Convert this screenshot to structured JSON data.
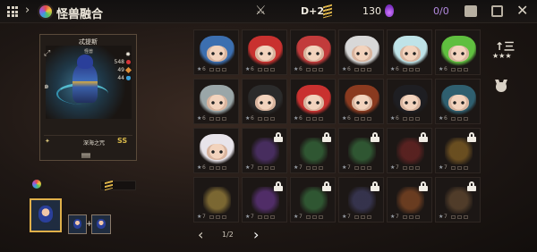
{
  "header": {
    "title": "怪兽融合",
    "level": "D+2",
    "gems": "130",
    "ratio": "0/0",
    "back_chevron": "›"
  },
  "detail": {
    "name": "忒提斯",
    "subtitle": "怪兽",
    "stats": {
      "hp": "548",
      "atk": "49",
      "def": "44"
    },
    "skill_name": "深海之咒",
    "skill_level": "SS"
  },
  "side": {
    "sort_label": "↑三",
    "stars_label": "★★★"
  },
  "pagination": {
    "text": "1/2",
    "prev": "‹",
    "next": "›"
  },
  "grid": {
    "cells": [
      {
        "row": 0,
        "col": 0,
        "type": "hero",
        "star": "★",
        "lv": "6",
        "hair": "#3c6fb0",
        "locked": false
      },
      {
        "row": 0,
        "col": 1,
        "type": "hero",
        "star": "★",
        "lv": "6",
        "hair": "#c9312f",
        "locked": false
      },
      {
        "row": 0,
        "col": 2,
        "type": "hero",
        "star": "★",
        "lv": "6",
        "hair": "#c23b3b",
        "locked": false
      },
      {
        "row": 0,
        "col": 3,
        "type": "hero",
        "star": "★",
        "lv": "6",
        "hair": "#d8d8d8",
        "locked": false
      },
      {
        "row": 0,
        "col": 4,
        "type": "hero",
        "star": "★",
        "lv": "6",
        "hair": "#bfe3e8",
        "locked": false
      },
      {
        "row": 0,
        "col": 5,
        "type": "hero",
        "star": "★",
        "lv": "6",
        "hair": "#5fbf3f",
        "locked": false
      },
      {
        "row": 1,
        "col": 0,
        "type": "hero",
        "star": "★",
        "lv": "6",
        "hair": "#9aa6a8",
        "locked": false
      },
      {
        "row": 1,
        "col": 1,
        "type": "hero",
        "star": "★",
        "lv": "6",
        "hair": "#2b2b2b",
        "locked": false
      },
      {
        "row": 1,
        "col": 2,
        "type": "hero",
        "star": "★",
        "lv": "6",
        "hair": "#c9312f",
        "locked": false
      },
      {
        "row": 1,
        "col": 3,
        "type": "hero",
        "star": "★",
        "lv": "6",
        "hair": "#8a3a1f",
        "locked": false
      },
      {
        "row": 1,
        "col": 4,
        "type": "hero",
        "star": "★",
        "lv": "6",
        "hair": "#1e1e22",
        "locked": false
      },
      {
        "row": 1,
        "col": 5,
        "type": "hero",
        "star": "★",
        "lv": "6",
        "hair": "#2f5f6f",
        "locked": false
      },
      {
        "row": 2,
        "col": 0,
        "type": "hero",
        "star": "★",
        "lv": "6",
        "hair": "#e8e4ea",
        "locked": false
      },
      {
        "row": 2,
        "col": 1,
        "type": "monster",
        "star": "★",
        "lv": "7",
        "tint": "#6a3f9a",
        "locked": true
      },
      {
        "row": 2,
        "col": 2,
        "type": "monster",
        "star": "★",
        "lv": "7",
        "tint": "#3f8a4a",
        "locked": true
      },
      {
        "row": 2,
        "col": 3,
        "type": "monster",
        "star": "★",
        "lv": "7",
        "tint": "#3f8a4a",
        "locked": true
      },
      {
        "row": 2,
        "col": 4,
        "type": "monster",
        "star": "★",
        "lv": "7",
        "tint": "#8a2a2a",
        "locked": true
      },
      {
        "row": 2,
        "col": 5,
        "type": "monster",
        "star": "★",
        "lv": "7",
        "tint": "#a87a2a",
        "locked": true
      },
      {
        "row": 3,
        "col": 0,
        "type": "monster",
        "star": "★",
        "lv": "7",
        "tint": "#c8a84a",
        "locked": false
      },
      {
        "row": 3,
        "col": 1,
        "type": "monster",
        "star": "★",
        "lv": "7",
        "tint": "#7a3faa",
        "locked": true
      },
      {
        "row": 3,
        "col": 2,
        "type": "monster",
        "star": "★",
        "lv": "7",
        "tint": "#3f8a4a",
        "locked": true
      },
      {
        "row": 3,
        "col": 3,
        "type": "monster",
        "star": "★",
        "lv": "7",
        "tint": "#4a4a7a",
        "locked": true
      },
      {
        "row": 3,
        "col": 4,
        "type": "monster",
        "star": "★",
        "lv": "7",
        "tint": "#a85a2a",
        "locked": true
      },
      {
        "row": 3,
        "col": 5,
        "type": "monster",
        "star": "★",
        "lv": "7",
        "tint": "#7a5a3a",
        "locked": true
      }
    ]
  },
  "colors": {
    "accent_gold": "#e0b04a",
    "gem_purple": "#b48be0",
    "cell_border": "#2e2622"
  }
}
